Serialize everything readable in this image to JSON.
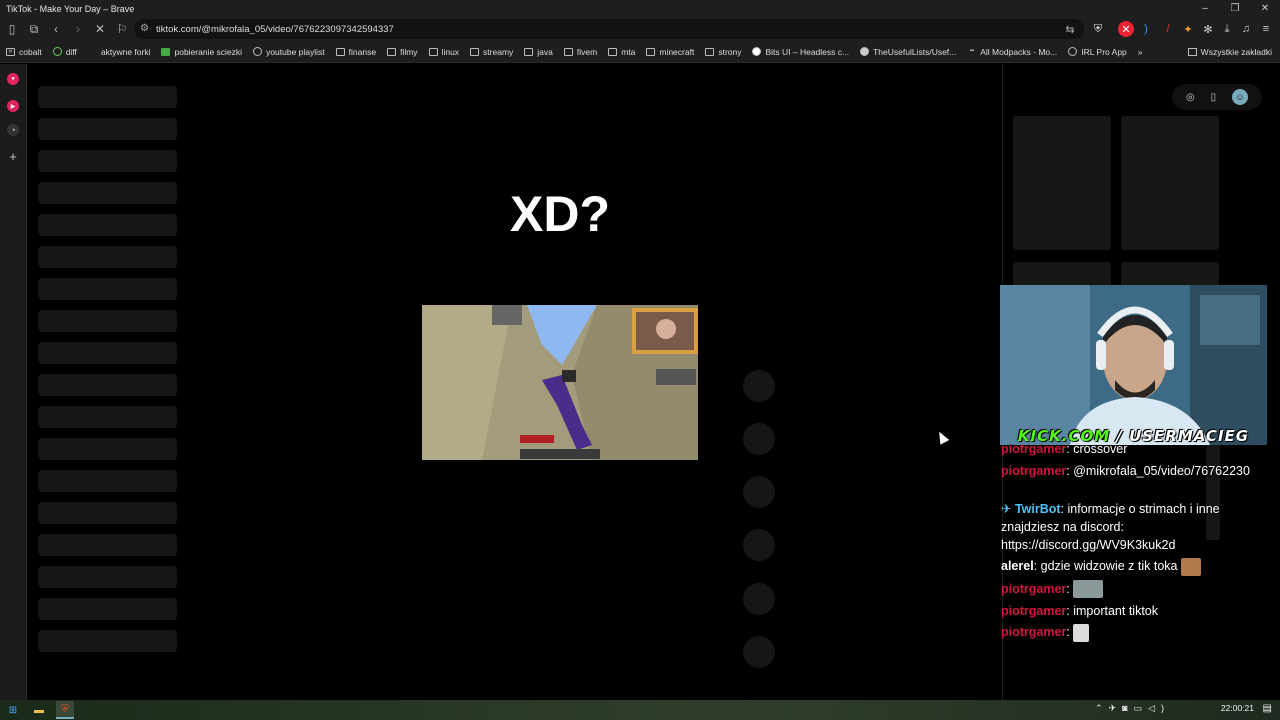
{
  "window": {
    "title": "TikTok - Make Your Day – Brave"
  },
  "address_bar": {
    "url": "tiktok.com/@mikrofala_05/video/7676223097342594337"
  },
  "bookmarks": {
    "items": [
      "cobalt",
      "diff",
      "aktywne forki",
      "pobieranie sciezki",
      "youtube playlist",
      "finanse",
      "filmy",
      "linux",
      "streamy",
      "java",
      "fivem",
      "mta",
      "minecraft",
      "strony",
      "Bits UI – Headless c...",
      "TheUsefulLists/Usef...",
      "All Modpacks - Mo...",
      "IRL Pro App"
    ],
    "more": "»",
    "all_bookmarks": "Wszystkie zakładki"
  },
  "page": {
    "heading": "XD?"
  },
  "overlay": {
    "kick_prefix": "KICK.COM",
    "kick_user": "USERMACIEG"
  },
  "chat": {
    "messages": [
      {
        "user": "piotrgamer",
        "text": ": crossover"
      },
      {
        "user": "piotrgamer",
        "text": ": @mikrofala_05/video/76762230"
      },
      {
        "user": "TwirBot",
        "text": ": informacje o strimach i inne znajdziesz na discord: https://discord.gg/WV9K3kuk2d"
      },
      {
        "user": "alerel",
        "text": ": gdzie widzowie z tik toka"
      },
      {
        "user": "piotrgamer",
        "text": ":"
      },
      {
        "user": "piotrgamer",
        "text": ": important tiktok"
      },
      {
        "user": "piotrgamer",
        "text": ":"
      }
    ]
  },
  "taskbar": {
    "time": "22:00:21"
  },
  "colors": {
    "chat_user_red": "#d6143e",
    "chat_bot_blue": "#4fc3f7",
    "kick_green": "#53fc18"
  }
}
